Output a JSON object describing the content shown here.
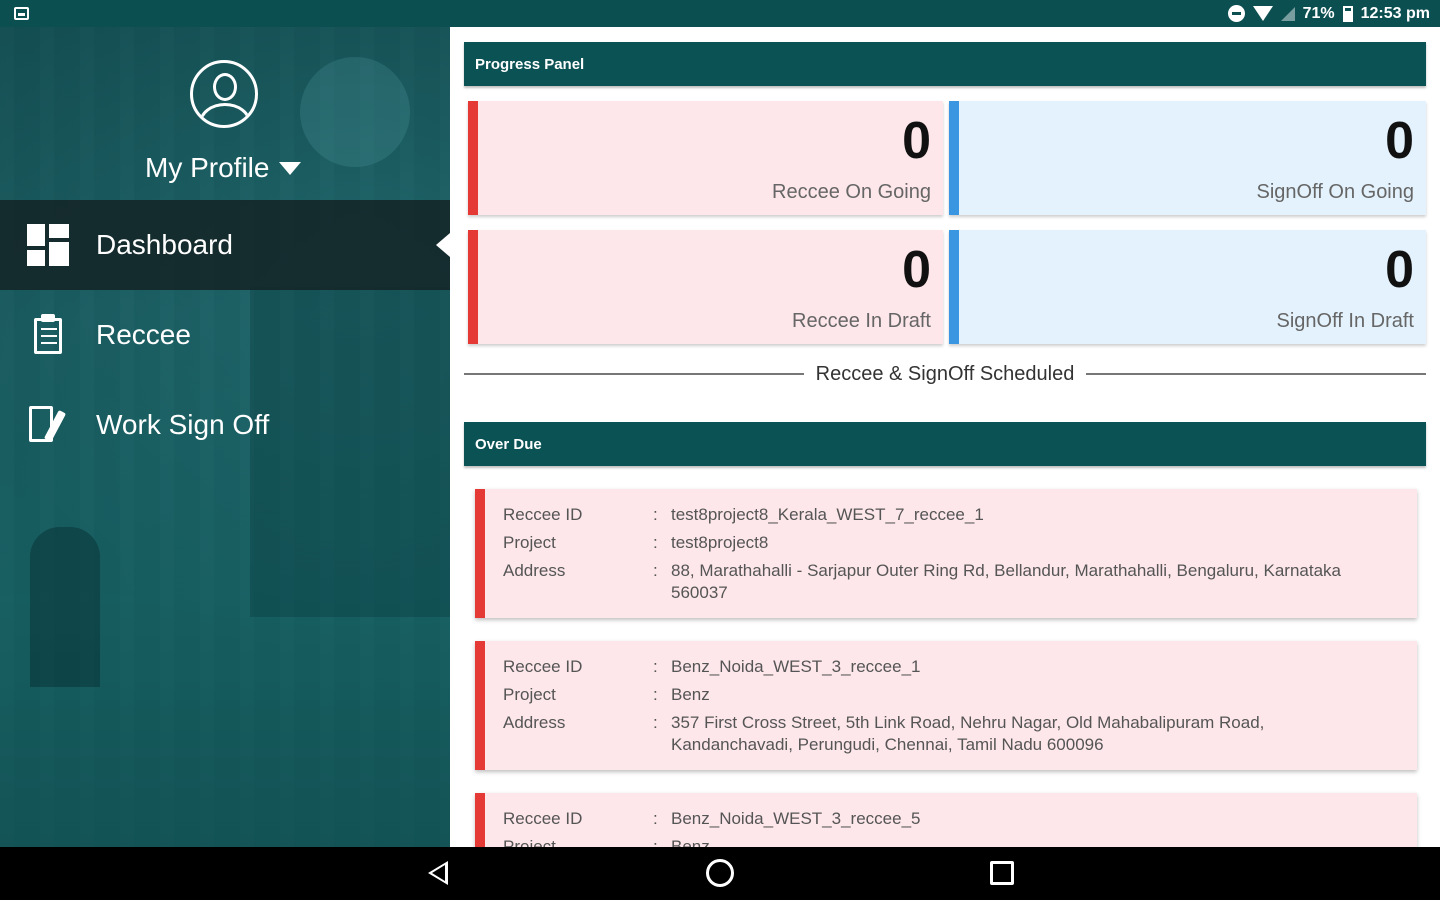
{
  "status_bar": {
    "battery": "71%",
    "time": "12:53 pm"
  },
  "sidebar": {
    "profile_label": "My Profile",
    "items": [
      {
        "label": "Dashboard",
        "icon": "dashboard-icon",
        "active": true
      },
      {
        "label": "Reccee",
        "icon": "clipboard-icon",
        "active": false
      },
      {
        "label": "Work Sign Off",
        "icon": "sign-off-icon",
        "active": false
      }
    ]
  },
  "progress_panel": {
    "title": "Progress Panel",
    "cards": [
      {
        "value": "0",
        "label": "Reccee On Going",
        "color": "#e53935"
      },
      {
        "value": "0",
        "label": "SignOff On Going",
        "color": "#3a96e0"
      },
      {
        "value": "0",
        "label": "Reccee In Draft",
        "color": "#e53935"
      },
      {
        "value": "0",
        "label": "SignOff In Draft",
        "color": "#3a96e0"
      }
    ]
  },
  "scheduled_divider": "Reccee & SignOff Scheduled",
  "overdue": {
    "title": "Over Due",
    "field_labels": {
      "reccee_id": "Reccee ID",
      "project": "Project",
      "address": "Address",
      "separator": ":"
    },
    "items": [
      {
        "reccee_id": "test8project8_Kerala_WEST_7_reccee_1",
        "project": "test8project8",
        "address": "88, Marathahalli - Sarjapur Outer Ring Rd, Bellandur, Marathahalli, Bengaluru, Karnataka 560037"
      },
      {
        "reccee_id": "Benz_Noida_WEST_3_reccee_1",
        "project": "Benz",
        "address": "357 First Cross Street, 5th Link Road, Nehru Nagar, Old Mahabalipuram Road, Kandanchavadi, Perungudi, Chennai, Tamil Nadu 600096"
      },
      {
        "reccee_id": "Benz_Noida_WEST_3_reccee_5",
        "project": "Benz",
        "address": ""
      }
    ]
  },
  "colors": {
    "header": "#0b5254",
    "status_bar": "#0c4f51",
    "red_accent": "#e53935",
    "blue_accent": "#3a96e0"
  }
}
